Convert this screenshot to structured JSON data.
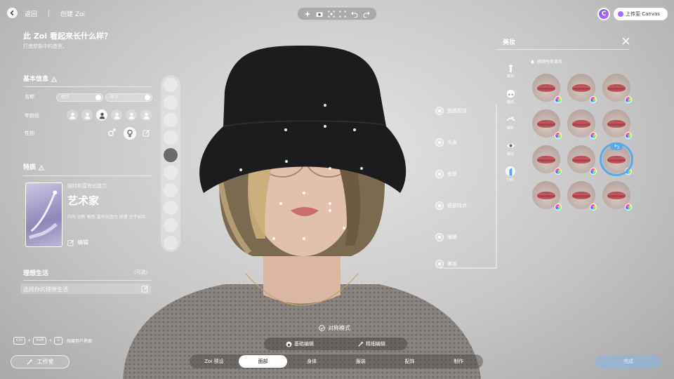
{
  "topbar": {
    "back_label": "返回",
    "title": "创建 Zoi",
    "upload_label": "上传至 Canvas",
    "canvas_badge": "C"
  },
  "question": {
    "title": "此 Zoi 看起来长什么样？",
    "subtitle": "打造想象中的造型。"
  },
  "basic_info": {
    "heading": "基本信息",
    "name_label": "名称",
    "first_name_placeholder": "姓氏",
    "last_name_placeholder": "名字",
    "age_label": "年龄段",
    "gender_label": "性别"
  },
  "traits": {
    "heading": "特质",
    "caption": "独特和富有创造力",
    "name": "艺术家",
    "tags": "内向 创新 敏感 富有创造力 浪漫 才干出众",
    "edit_label": "编辑"
  },
  "ideal_life": {
    "heading": "理想生活",
    "optional": "(可选)",
    "placeholder": "选择你的理想生活"
  },
  "face_labels": [
    "面部预设",
    "头发",
    "皮肤",
    "面部特点",
    "眼睛",
    "美妆"
  ],
  "makeup": {
    "title": "美妆",
    "remove_all": "移除所有美妆",
    "categories": [
      "高光",
      "腮红",
      "眼影",
      "眼线",
      "口红"
    ],
    "selected_category": "口红",
    "swatch_count": 12,
    "selected_swatch": 9
  },
  "bottom": {
    "symmetry": "对称模式",
    "basic_edit": "基础编辑",
    "fine_edit": "精细编辑",
    "tabs": [
      "Zoi 预设",
      "面部",
      "身体",
      "服装",
      "配饰",
      "制作"
    ],
    "active_tab": "面部",
    "studio": "工作室",
    "done": "完成",
    "shortcut_keys": [
      "Ctrl",
      "Shift",
      "U"
    ],
    "shortcut_label": "隐藏用户界面"
  },
  "colors": {
    "accent": "#5aa9ef",
    "lip": "#c85a61"
  }
}
